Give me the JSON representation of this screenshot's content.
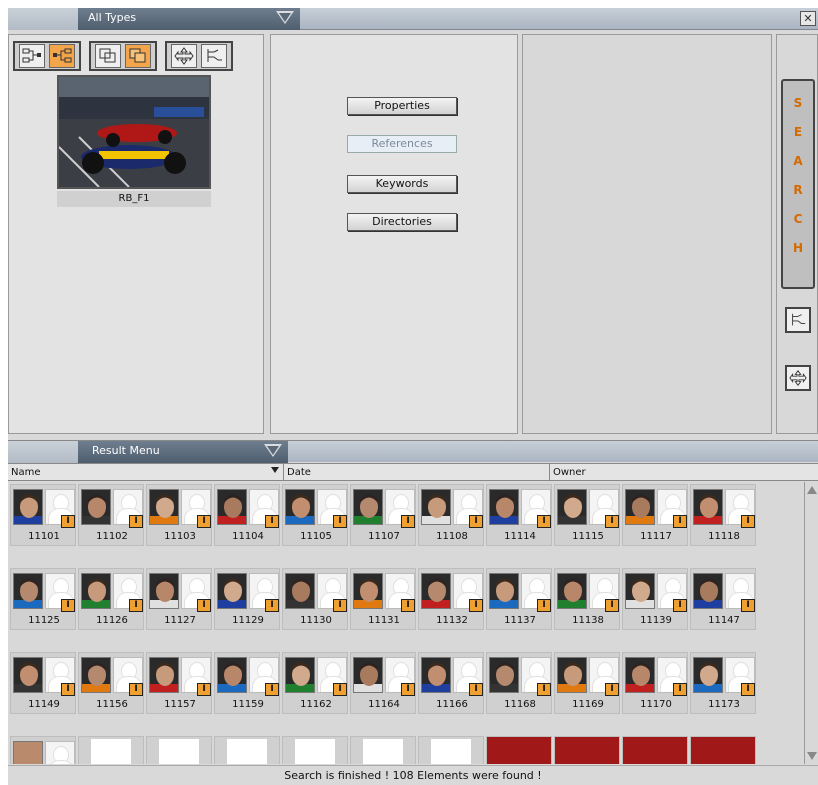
{
  "window": {
    "close_label": "✕"
  },
  "type_filter": {
    "selected": "All Types"
  },
  "preview": {
    "caption": "RB_F1"
  },
  "actions": {
    "properties": "Properties",
    "references": "References",
    "keywords": "Keywords",
    "directories": "Directories"
  },
  "search_panel": {
    "letters": [
      "S",
      "E",
      "A",
      "R",
      "C",
      "H"
    ]
  },
  "result_menu": {
    "label": "Result Menu"
  },
  "columns": {
    "name": "Name",
    "date": "Date",
    "owner": "Owner"
  },
  "results": {
    "row1": [
      "11101",
      "11102",
      "11103",
      "11104",
      "11105",
      "11107",
      "11108",
      "11114",
      "11115",
      "11117",
      "11118"
    ],
    "row2": [
      "11125",
      "11126",
      "11127",
      "11129",
      "11130",
      "11131",
      "11132",
      "11137",
      "11138",
      "11139",
      "11147"
    ],
    "row3": [
      "11149",
      "11156",
      "11157",
      "11159",
      "11162",
      "11164",
      "11166",
      "11168",
      "11169",
      "11170",
      "11173"
    ],
    "badge": "I"
  },
  "status": "Search is finished ! 108 Elements were found !"
}
